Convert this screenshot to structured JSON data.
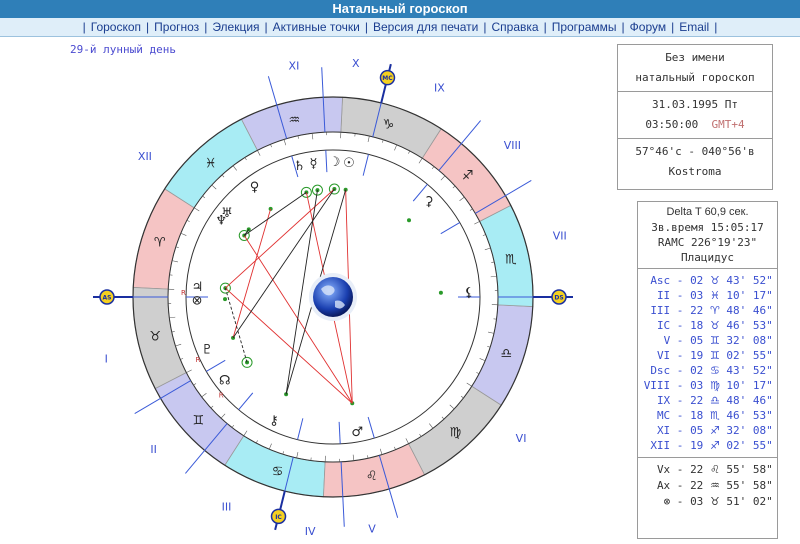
{
  "header": {
    "title": "Натальный гороскоп"
  },
  "nav": {
    "items": [
      "Гороскоп",
      "Прогноз",
      "Элекция",
      "Активные точки",
      "Версия для печати",
      "Справка",
      "Программы",
      "Форум",
      "Email"
    ]
  },
  "lunar_day": "29-й лунный день",
  "info": {
    "name": "Без имени",
    "type": "натальный гороскоп",
    "date": "31.03.1995 Пт",
    "time": "03:50:00",
    "gmt": "GMT+4",
    "coords": "57°46'с - 040°56'в",
    "city": "Kostroma"
  },
  "calc": {
    "delta_t": "Delta T  60,9 сек.",
    "sidereal": "Зв.время 15:05:17",
    "ramc": "RAMC 226°19'23\"",
    "system": "Плацидус"
  },
  "cusps": [
    {
      "label": "Asc",
      "deg": "02",
      "sign": "♉",
      "min": "43' 52\""
    },
    {
      "label": "II",
      "deg": "03",
      "sign": "♓",
      "min": "10' 17\""
    },
    {
      "label": "III",
      "deg": "22",
      "sign": "♈",
      "min": "48' 46\""
    },
    {
      "label": "IC",
      "deg": "18",
      "sign": "♉",
      "min": "46' 53\""
    },
    {
      "label": "V",
      "deg": "05",
      "sign": "♊",
      "min": "32' 08\""
    },
    {
      "label": "VI",
      "deg": "19",
      "sign": "♊",
      "min": "02' 55\""
    },
    {
      "label": "Dsc",
      "deg": "02",
      "sign": "♋",
      "min": "43' 52\""
    },
    {
      "label": "VIII",
      "deg": "03",
      "sign": "♍",
      "min": "10' 17\""
    },
    {
      "label": "IX",
      "deg": "22",
      "sign": "♎",
      "min": "48' 46\""
    },
    {
      "label": "MC",
      "deg": "18",
      "sign": "♏",
      "min": "46' 53\""
    },
    {
      "label": "XI",
      "deg": "05",
      "sign": "♐",
      "min": "32' 08\""
    },
    {
      "label": "XII",
      "deg": "19",
      "sign": "♐",
      "min": "02' 55\""
    }
  ],
  "points": [
    {
      "label": "Vx",
      "deg": "22",
      "sign": "♌",
      "min": "55' 58\""
    },
    {
      "label": "Ax",
      "deg": "22",
      "sign": "♒",
      "min": "55' 58\""
    },
    {
      "label": "⊗",
      "deg": "03",
      "sign": "♉",
      "min": "51' 02\""
    }
  ],
  "wheel": {
    "signs": [
      "♈",
      "♉",
      "♊",
      "♋",
      "♌",
      "♍",
      "♎",
      "♏",
      "♐",
      "♑",
      "♒",
      "♓"
    ],
    "house_labels": [
      "I",
      "II",
      "III",
      "IV",
      "V",
      "VI",
      "VII",
      "VIII",
      "IX",
      "X",
      "XI",
      "XII"
    ],
    "axis_labels": {
      "asc": "AS",
      "dsc": "DS",
      "mc": "MC",
      "ic": "IC"
    },
    "planet_glyphs": [
      "♆",
      "♅",
      "♀",
      "♄",
      "☿",
      "☽",
      "☉",
      "♃",
      "♇",
      "☊",
      "♂",
      "⚷",
      "⚸",
      "⚳",
      "⊗"
    ],
    "retro_mark": "R",
    "colors": {
      "fire": "#f5c4c4",
      "earth": "#cfcfcf",
      "air": "#c8c8f0",
      "water": "#a8ecf4",
      "aspect_red": "#e03030",
      "aspect_black": "#222222",
      "house_line": "#3a5ad8"
    }
  }
}
